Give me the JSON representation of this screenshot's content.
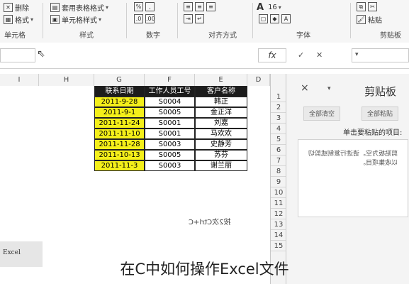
{
  "ribbon": {
    "items": {
      "delete": "删除",
      "format": "格式",
      "table_format": "套用表格格式",
      "cell_style": "单元格样式",
      "font_size": "16",
      "font_glyph": "A",
      "paste_label": "粘贴"
    },
    "groups": {
      "cells": "单元格",
      "styles": "样式",
      "number": "数字",
      "alignment": "对齐方式",
      "font": "字体",
      "clipboard": "剪贴板"
    }
  },
  "formula_bar": {
    "fx": "fx"
  },
  "columns": [
    "I",
    "H",
    "G",
    "F",
    "E",
    "D"
  ],
  "rows": [
    "1",
    "2",
    "3",
    "4",
    "5",
    "6",
    "7",
    "8",
    "9",
    "10",
    "11",
    "12",
    "13",
    "14",
    "15"
  ],
  "table": {
    "headers": [
      "联系日期",
      "工作人员工号",
      "客户名称"
    ],
    "rows": [
      [
        "2011-9-28",
        "S0004",
        "韩正"
      ],
      [
        "2011-9-1",
        "S0005",
        "金正洋"
      ],
      [
        "2011-11-24",
        "S0001",
        "刘嘉"
      ],
      [
        "2011-11-10",
        "S0001",
        "马欢欢"
      ],
      [
        "2011-11-28",
        "S0003",
        "史静芳"
      ],
      [
        "2011-10-13",
        "S0005",
        "苏芬"
      ],
      [
        "2011-11-3",
        "S0003",
        "谢兰丽"
      ]
    ]
  },
  "sheet_note": "按2次Ctrl+C",
  "sheet_tab": "Excel",
  "clipboard_pane": {
    "title": "剪贴板",
    "paste_all": "全部粘贴",
    "clear_all": "全部清空",
    "prompt": "单击要粘贴的项目:",
    "item_text": "剪贴板为空。请进行复制或剪切以收集项目。",
    "close_symbol": "×"
  },
  "caption": "在C中如何操作Excel文件"
}
